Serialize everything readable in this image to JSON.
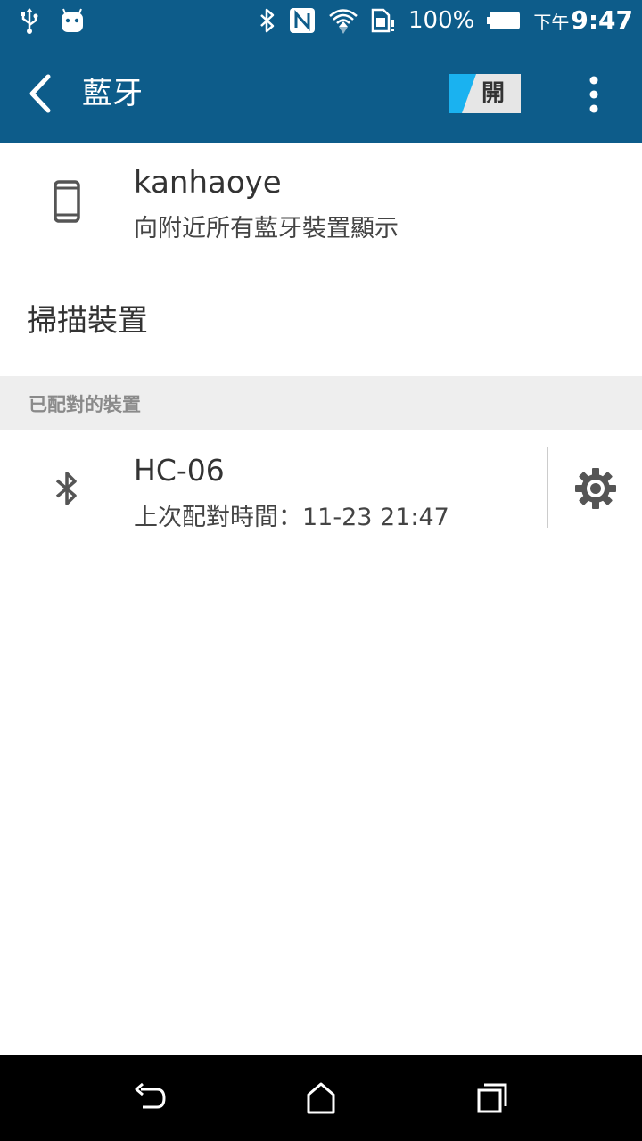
{
  "status_bar": {
    "battery": "100%",
    "time_prefix": "下午",
    "time": "9:47",
    "icons": [
      "usb-icon",
      "android-icon",
      "bluetooth-icon",
      "nfc-icon",
      "wifi-icon",
      "sim-alert-icon",
      "battery-icon"
    ]
  },
  "app_bar": {
    "title": "藍牙",
    "toggle_label": "開",
    "toggle_accent": "#1ab2f0",
    "background": "#0d5c8a"
  },
  "this_device": {
    "name": "kanhaoye",
    "subtitle": "向附近所有藍牙裝置顯示"
  },
  "scan_label": "掃描裝置",
  "paired_section": {
    "header": "已配對的裝置",
    "devices": [
      {
        "name": "HC-06",
        "subtitle": "上次配對時間：11-23 21:47"
      }
    ]
  },
  "nav_bar": {
    "buttons": [
      "back-icon",
      "home-icon",
      "recents-icon"
    ]
  }
}
